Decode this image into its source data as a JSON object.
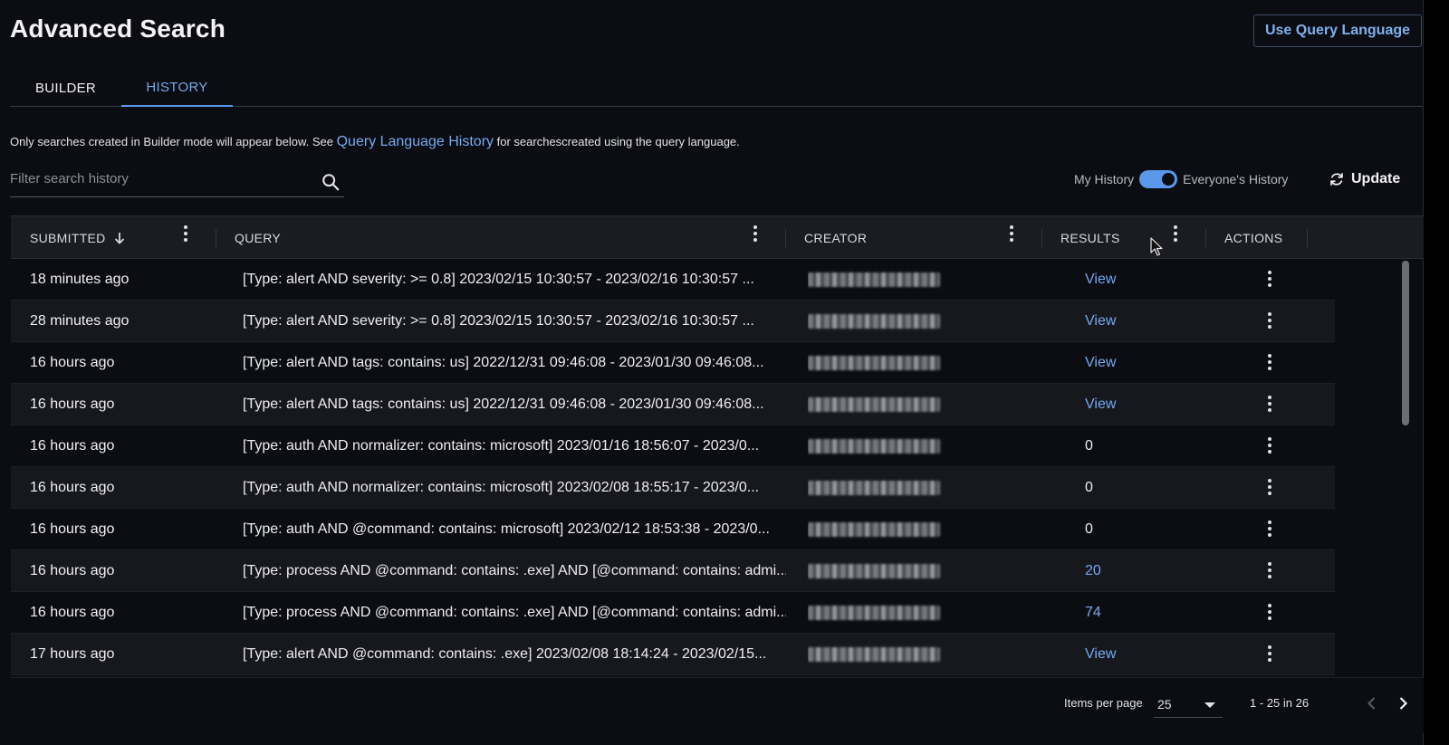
{
  "page": {
    "title": "Advanced Search",
    "query_language_button": "Use Query Language"
  },
  "tabs": [
    {
      "label": "BUILDER"
    },
    {
      "label": "HISTORY"
    }
  ],
  "info": {
    "prefix": "Only searches created in Builder mode will appear below. See ",
    "link": "Query Language History",
    "suffix": " for searchescreated using the query language."
  },
  "filter": {
    "placeholder": "Filter search history",
    "value": ""
  },
  "history_toggle": {
    "left_label": "My History",
    "right_label": "Everyone's History",
    "state": "on"
  },
  "update_label": "Update",
  "table": {
    "columns": [
      {
        "label": "SUBMITTED",
        "sort": "descending"
      },
      {
        "label": "QUERY"
      },
      {
        "label": "CREATOR"
      },
      {
        "label": "RESULTS"
      },
      {
        "label": "ACTIONS"
      }
    ],
    "rows": [
      {
        "submitted": "18 minutes ago",
        "query": "[Type: alert AND severity: >= 0.8] 2023/02/15 10:30:57 - 2023/02/16 10:30:57 ...",
        "result": "View",
        "result_is_link": true
      },
      {
        "submitted": "28 minutes ago",
        "query": "[Type: alert AND severity: >= 0.8] 2023/02/15 10:30:57 - 2023/02/16 10:30:57 ...",
        "result": "View",
        "result_is_link": true
      },
      {
        "submitted": "16 hours ago",
        "query": "[Type: alert AND tags: contains: us] 2022/12/31 09:46:08 - 2023/01/30 09:46:08...",
        "result": "View",
        "result_is_link": true
      },
      {
        "submitted": "16 hours ago",
        "query": "[Type: alert AND tags: contains: us] 2022/12/31 09:46:08 - 2023/01/30 09:46:08...",
        "result": "View",
        "result_is_link": true
      },
      {
        "submitted": "16 hours ago",
        "query": "[Type: auth AND normalizer: contains: microsoft] 2023/01/16 18:56:07 - 2023/0...",
        "result": "0",
        "result_is_link": false
      },
      {
        "submitted": "16 hours ago",
        "query": "[Type: auth AND normalizer: contains: microsoft] 2023/02/08 18:55:17 - 2023/0...",
        "result": "0",
        "result_is_link": false
      },
      {
        "submitted": "16 hours ago",
        "query": "[Type: auth AND @command: contains: microsoft] 2023/02/12 18:53:38 - 2023/0...",
        "result": "0",
        "result_is_link": false
      },
      {
        "submitted": "16 hours ago",
        "query": "[Type: process AND @command: contains: .exe] AND [@command: contains: admi...",
        "result": "20",
        "result_is_link": true
      },
      {
        "submitted": "16 hours ago",
        "query": "[Type: process AND @command: contains: .exe] AND [@command: contains: admi...",
        "result": "74",
        "result_is_link": true
      },
      {
        "submitted": "17 hours ago",
        "query": "[Type: alert AND @command: contains: .exe] 2023/02/08 18:14:24 - 2023/02/15...",
        "result": "View",
        "result_is_link": true
      }
    ]
  },
  "pagination": {
    "items_per_page_label": "Items per page",
    "items_per_page": "25",
    "range": "1 - 25 in 26"
  },
  "colors": {
    "accent": "#5a98ea",
    "link": "#74a9ef",
    "background": "#0c0d12",
    "header": "#1b1c22"
  },
  "icons": [
    "search-icon",
    "refresh-icon",
    "sort-down-arrow-icon",
    "kebab-menu-icon",
    "chevron-left-icon",
    "chevron-right-icon",
    "caret-down-icon",
    "mouse-cursor-icon"
  ]
}
